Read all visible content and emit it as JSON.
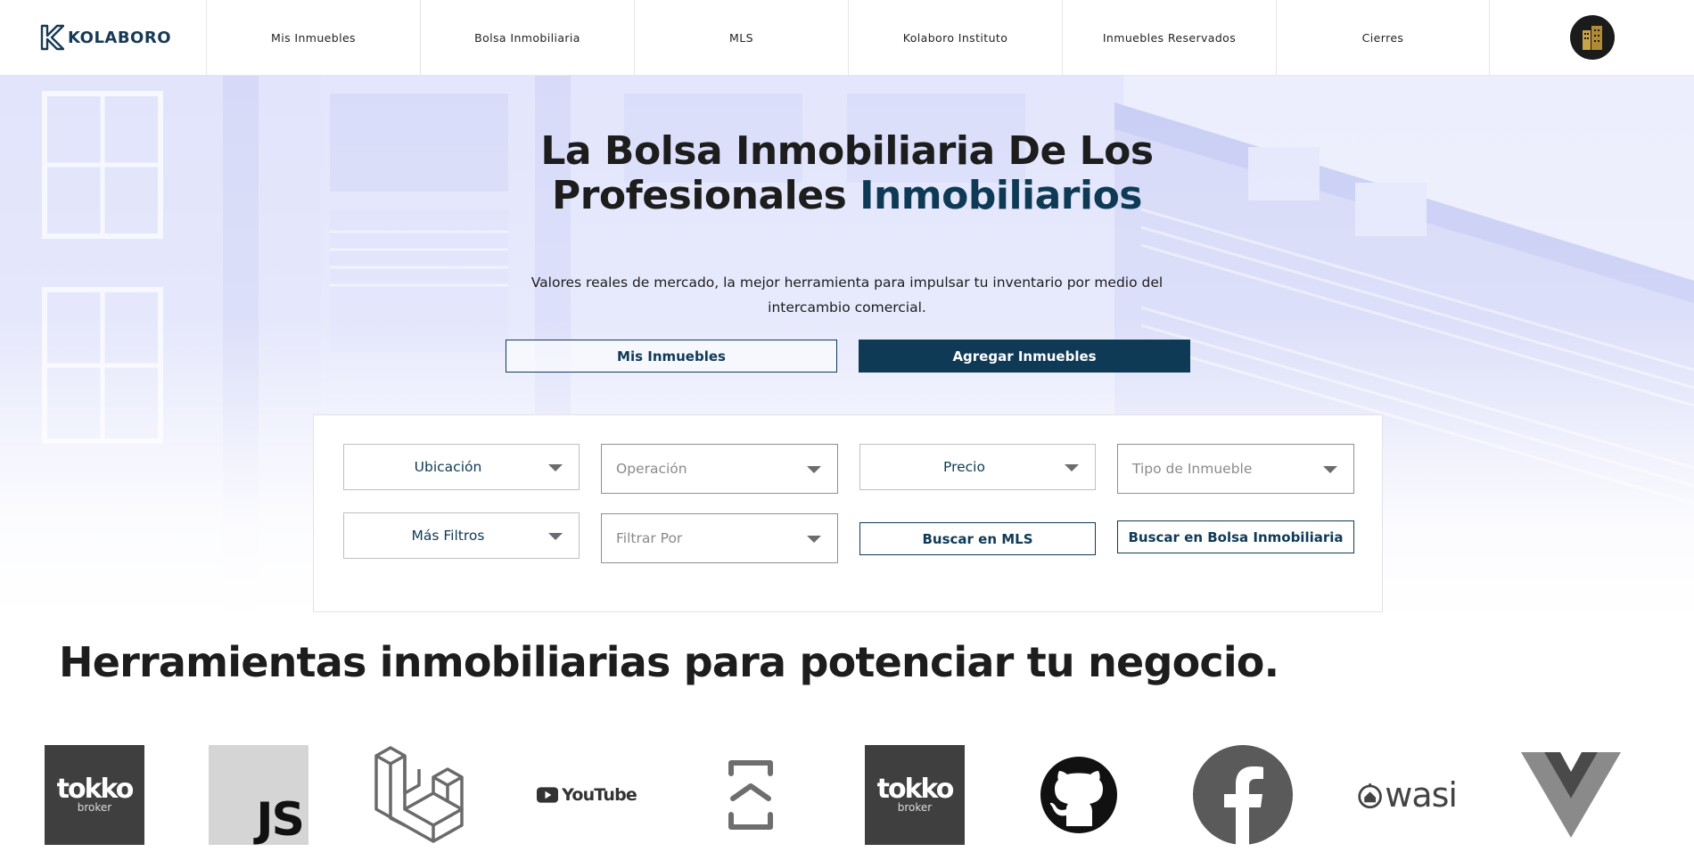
{
  "brand": {
    "name": "KOLABORO",
    "primary_color": "#0f3a56"
  },
  "nav": {
    "items": [
      {
        "label": "Mis Inmuebles"
      },
      {
        "label": "Bolsa Inmobiliaria"
      },
      {
        "label": "MLS"
      },
      {
        "label": "Kolaboro Instituto"
      },
      {
        "label": "Inmuebles Reservados"
      },
      {
        "label": "Cierres"
      }
    ],
    "avatar_icon": "user-avatar-building-icon"
  },
  "hero": {
    "title_part1": "La Bolsa Inmobiliaria De Los Profesionales ",
    "title_accent": "Inmobiliarios",
    "subtitle": "Valores reales de mercado, la mejor herramienta para impulsar tu inventario por medio del intercambio comercial.",
    "btn_mis_inmuebles": "Mis Inmuebles",
    "btn_agregar": "Agregar Inmuebles"
  },
  "filters": {
    "ubicacion": "Ubicación",
    "operacion_placeholder": "Operación",
    "precio": "Precio",
    "tipo_placeholder": "Tipo de Inmueble",
    "mas_filtros": "Más Filtros",
    "filtrar_placeholder": "Filtrar Por",
    "btn_mls": "Buscar en MLS",
    "btn_bolsa": "Buscar en Bolsa Inmobiliaria"
  },
  "tools": {
    "title": "Herramientas inmobiliarias para potenciar tu negocio.",
    "logos": [
      {
        "icon": "tokko-broker-logo",
        "word": "tokko",
        "sub": "broker"
      },
      {
        "icon": "javascript-logo",
        "word": "JS"
      },
      {
        "icon": "laravel-logo"
      },
      {
        "icon": "youtube-logo",
        "word": "YouTube"
      },
      {
        "icon": "bracket-scan-logo"
      },
      {
        "icon": "tokko-broker-logo",
        "word": "tokko",
        "sub": "broker"
      },
      {
        "icon": "github-logo"
      },
      {
        "icon": "facebook-logo"
      },
      {
        "icon": "wasi-logo",
        "word": "wasi"
      },
      {
        "icon": "vue-logo"
      }
    ]
  }
}
